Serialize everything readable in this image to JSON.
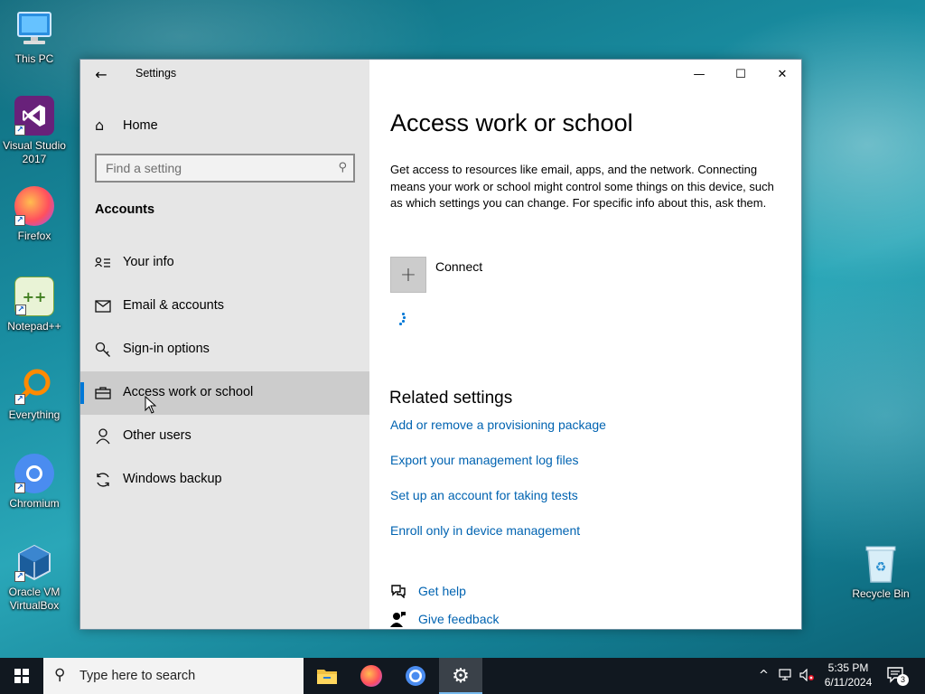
{
  "desktop": {
    "icons": [
      {
        "label": "This PC",
        "icon": "computer-icon"
      },
      {
        "label": "Visual Studio 2017",
        "icon": "visual-studio-icon"
      },
      {
        "label": "Firefox",
        "icon": "firefox-icon"
      },
      {
        "label": "Notepad++",
        "icon": "notepad-plus-plus-icon"
      },
      {
        "label": "Everything",
        "icon": "everything-search-icon"
      },
      {
        "label": "Chromium",
        "icon": "chromium-icon"
      },
      {
        "label": "Oracle VM VirtualBox",
        "icon": "virtualbox-icon"
      },
      {
        "label": "Recycle Bin",
        "icon": "recycle-bin-icon"
      }
    ]
  },
  "window": {
    "title": "Settings",
    "controls": {
      "minimize": "—",
      "maximize": "☐",
      "close": "✕"
    }
  },
  "sidebar": {
    "home_label": "Home",
    "search_placeholder": "Find a setting",
    "section_title": "Accounts",
    "items": [
      {
        "label": "Your info",
        "icon": "person-card-icon",
        "selected": false
      },
      {
        "label": "Email & accounts",
        "icon": "mail-icon",
        "selected": false
      },
      {
        "label": "Sign-in options",
        "icon": "key-icon",
        "selected": false
      },
      {
        "label": "Access work or school",
        "icon": "briefcase-icon",
        "selected": true
      },
      {
        "label": "Other users",
        "icon": "person-icon",
        "selected": false
      },
      {
        "label": "Windows backup",
        "icon": "sync-icon",
        "selected": false
      }
    ]
  },
  "main": {
    "title": "Access work or school",
    "description": "Get access to resources like email, apps, and the network. Connecting means your work or school might control some things on this device, such as which settings you can change. For specific info about this, ask them.",
    "connect_label": "Connect",
    "related_title": "Related settings",
    "related_links": [
      "Add or remove a provisioning package",
      "Export your management log files",
      "Set up an account for taking tests",
      "Enroll only in device management"
    ],
    "get_help": "Get help",
    "give_feedback": "Give feedback"
  },
  "taskbar": {
    "search_placeholder": "Type here to search",
    "apps": [
      "file-explorer-icon",
      "firefox-icon",
      "chromium-icon",
      "settings-gear-icon"
    ],
    "time": "5:35 PM",
    "date": "6/11/2024",
    "notification_count": "3"
  },
  "colors": {
    "accent": "#0078d7",
    "link": "#0063b1",
    "sidebar_bg": "#e6e6e6",
    "selected_bg": "#cccccc",
    "taskbar_bg": "#111820"
  }
}
